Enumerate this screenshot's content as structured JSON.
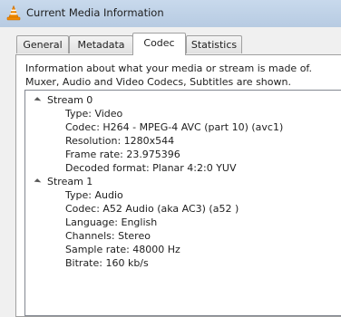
{
  "window": {
    "title": "Current Media Information"
  },
  "tabs": [
    {
      "label": "General",
      "active": false
    },
    {
      "label": "Metadata",
      "active": false
    },
    {
      "label": "Codec",
      "active": true
    },
    {
      "label": "Statistics",
      "active": false
    }
  ],
  "codec": {
    "description_line1": "Information about what your media or stream is made of.",
    "description_line2": "Muxer, Audio and Video Codecs, Subtitles are shown.",
    "streams": [
      {
        "title": "Stream 0",
        "expanded": true,
        "fields": [
          "Type: Video",
          "Codec: H264 - MPEG-4 AVC (part 10) (avc1)",
          "Resolution: 1280x544",
          "Frame rate: 23.975396",
          "Decoded format: Planar 4:2:0 YUV"
        ]
      },
      {
        "title": "Stream 1",
        "expanded": true,
        "fields": [
          "Type: Audio",
          "Codec: A52 Audio (aka AC3) (a52 )",
          "Language: English",
          "Channels: Stereo",
          "Sample rate: 48000 Hz",
          "Bitrate: 160 kb/s"
        ]
      }
    ]
  },
  "icons": {
    "app": "vlc-cone-icon",
    "expander": "expanded-triangle-icon"
  },
  "colors": {
    "titlebar": "#bcd0e6",
    "vlc_orange": "#f08a00",
    "panel_bg": "#ffffff",
    "window_bg": "#f0f0f0"
  }
}
